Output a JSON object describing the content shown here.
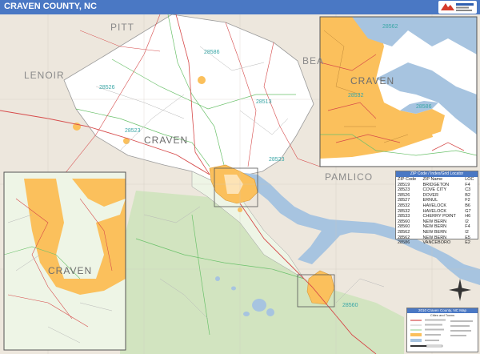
{
  "header": {
    "title": "CRAVEN COUNTY, NC"
  },
  "labels": {
    "pitt": "PITT",
    "lenoir": "LENOIR",
    "beaufort_partial": "BEA",
    "pamlico": "PAMLICO",
    "craven_main": "CRAVEN",
    "craven_inset_ne": "CRAVEN",
    "craven_inset_w": "CRAVEN"
  },
  "zips_on_map": [
    "28586",
    "28526",
    "28513",
    "28523",
    "28523",
    "28560",
    "28532",
    "28562",
    "28586"
  ],
  "zip_table": {
    "title": "ZIP Code / Index/Grid Locator",
    "columns": [
      "ZIP Code",
      "ZIP Name",
      "LOC"
    ],
    "rows": [
      [
        "28519",
        "BRIDGETON",
        "F4"
      ],
      [
        "28523",
        "COVE CITY",
        "C3"
      ],
      [
        "28526",
        "DOVER",
        "B2"
      ],
      [
        "28527",
        "ERNUL",
        "F2"
      ],
      [
        "28532",
        "HAVELOCK",
        "B6"
      ],
      [
        "28532",
        "HAVELOCK",
        "G7"
      ],
      [
        "28533",
        "CHERRY POINT",
        "H6"
      ],
      [
        "28560",
        "NEW BERN",
        "I2"
      ],
      [
        "28560",
        "NEW BERN",
        "F4"
      ],
      [
        "28562",
        "NEW BERN",
        "I2"
      ],
      [
        "28562",
        "NEW BERN",
        "E5"
      ],
      [
        "28586",
        "VANCEBORO",
        "E2"
      ]
    ]
  },
  "legend": {
    "title": "2010 Craven County, NC Map",
    "subtitle": "Cities and Towns"
  },
  "colors": {
    "title_bar": "#4a78c4",
    "urban": "#fbc05c",
    "water": "#a7c4e0",
    "county": "#ffffff",
    "land": "#ede7dd",
    "forest": "#d2e4c0",
    "zip_label": "#3aa6a6"
  }
}
